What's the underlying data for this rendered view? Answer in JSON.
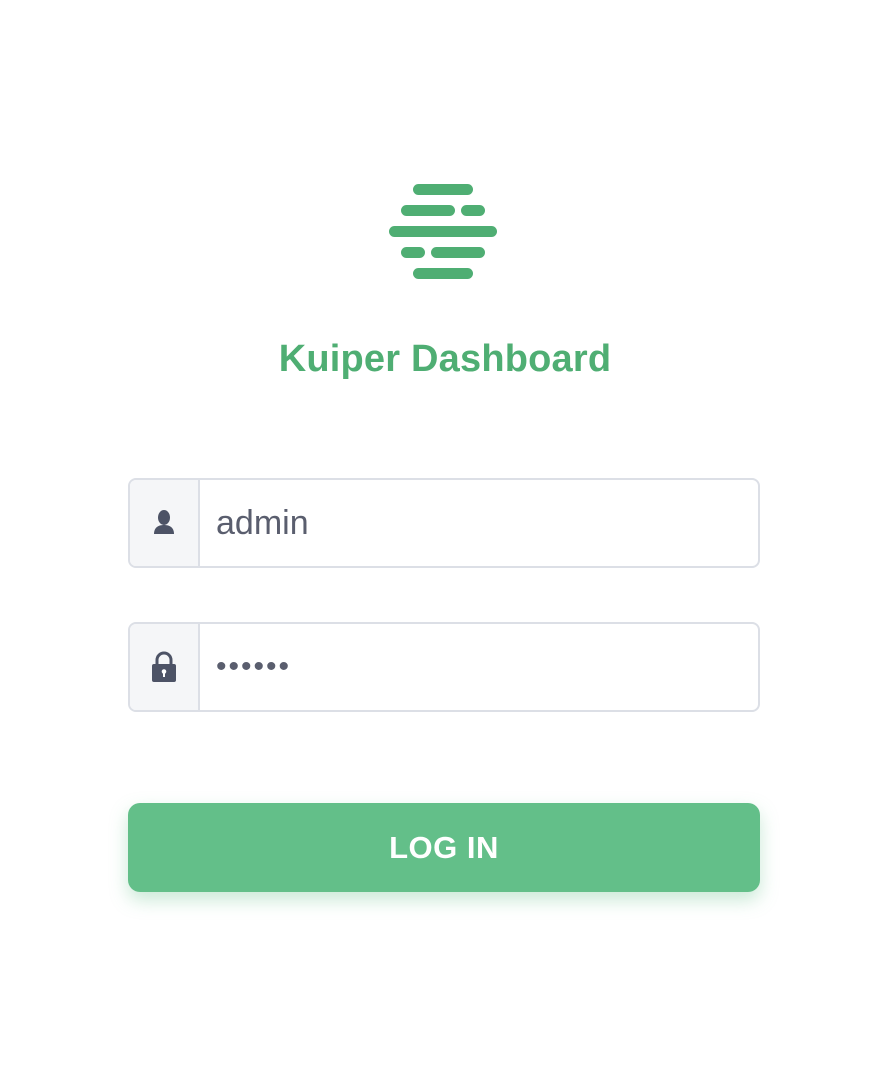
{
  "app": {
    "title": "Kuiper Dashboard",
    "logo_icon": "kuiper-logo-icon"
  },
  "colors": {
    "brand": "#4fae73",
    "button": "#63bf89",
    "button_text": "#ffffff",
    "icon": "#4d5366"
  },
  "login": {
    "username": {
      "icon": "user-icon",
      "value": "admin"
    },
    "password": {
      "icon": "lock-icon",
      "value": "••••••"
    },
    "submit_label": "LOG IN"
  }
}
